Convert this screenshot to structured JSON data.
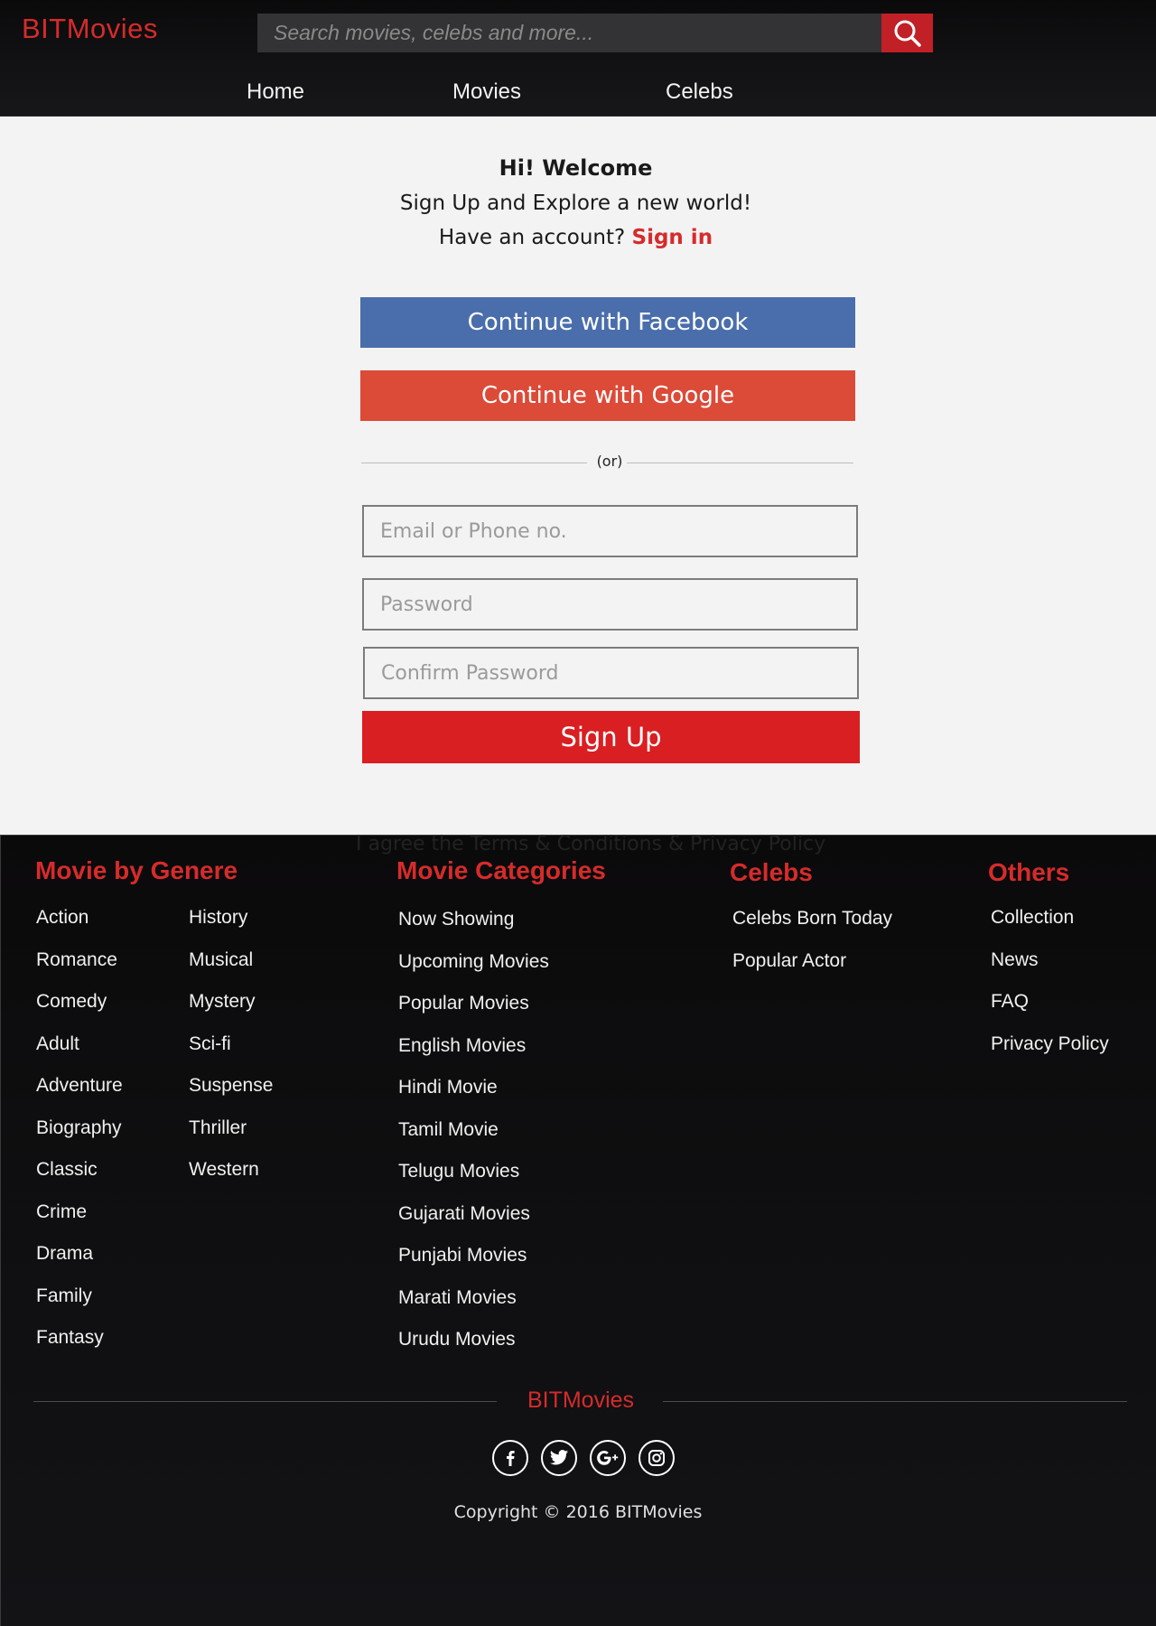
{
  "header": {
    "logo": "BITMovies",
    "search_placeholder": "Search movies, celebs and more...",
    "nav": [
      "Home",
      "Movies",
      "Celebs"
    ]
  },
  "main": {
    "welcome_title": "Hi! Welcome",
    "subtitle": "Sign Up and Explore a new world!",
    "have_account": "Have an account?",
    "signin_link": "Sign in",
    "facebook_button": "Continue with Facebook",
    "google_button": "Continue with Google",
    "or_text": "(or)",
    "email_placeholder": "Email or Phone no.",
    "password_placeholder": "Password",
    "confirm_placeholder": "Confirm Password",
    "signup_button": "Sign Up",
    "terms_text": "I agree the Terms & Conditions & Privacy Policy"
  },
  "footer": {
    "genre_heading": "Movie by Genere",
    "genres_col1": [
      "Action",
      "Romance",
      "Comedy",
      "Adult",
      "Adventure",
      "Biography",
      "Classic",
      "Crime",
      "Drama",
      "Family",
      "Fantasy"
    ],
    "genres_col2": [
      "History",
      "Musical",
      "Mystery",
      "Sci-fi",
      "Suspense",
      "Thriller",
      "Western"
    ],
    "categories_heading": "Movie Categories",
    "categories": [
      "Now Showing",
      "Upcoming Movies",
      "Popular Movies",
      "English Movies",
      "Hindi Movie",
      "Tamil Movie",
      "Telugu Movies",
      "Gujarati Movies",
      "Punjabi Movies",
      "Marati Movies",
      "Urudu Movies"
    ],
    "celebs_heading": "Celebs",
    "celebs": [
      "Celebs Born Today",
      "Popular Actor"
    ],
    "others_heading": "Others",
    "others": [
      "Collection",
      "News",
      "FAQ",
      "Privacy Policy"
    ],
    "logo": "BITMovies",
    "social_icons": [
      "facebook-icon",
      "twitter-icon",
      "google-plus-icon",
      "instagram-icon"
    ],
    "copyright": "Copyright © 2016 BITMovies"
  },
  "colors": {
    "brand_red": "#d62b2b",
    "facebook_blue": "#4a6eab",
    "google_red": "#dc4a38",
    "signup_red": "#d91f22"
  }
}
